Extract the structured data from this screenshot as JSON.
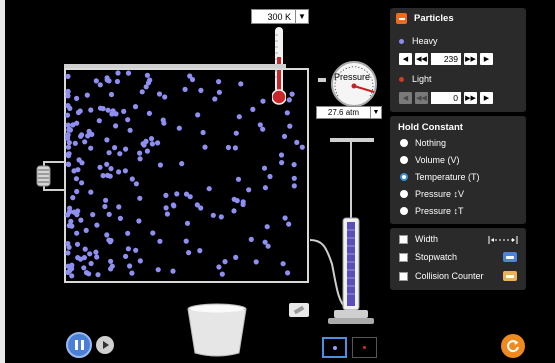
{
  "temperature": {
    "value": "300 K",
    "dropdown": "▼"
  },
  "pressure": {
    "label": "Pressure",
    "value": "27.6 atm",
    "dropdown": "▼"
  },
  "particles": {
    "title": "Particles",
    "heavy": {
      "label": "Heavy",
      "value": "239",
      "color": "#8b8bf0"
    },
    "light": {
      "label": "Light",
      "value": "0",
      "color": "#d33b1f"
    }
  },
  "hold_constant": {
    "title": "Hold Constant",
    "options": [
      "Nothing",
      "Volume (V)",
      "Temperature (T)",
      "Pressure ↕V",
      "Pressure ↕T"
    ],
    "selected": "Temperature (T)"
  },
  "tools": {
    "width": "Width",
    "stopwatch": "Stopwatch",
    "collision_counter": "Collision Counter"
  },
  "colors": {
    "accent": "#ef6a1e",
    "panel": "#2a2a2a",
    "molecule": "#8f8ff2"
  }
}
